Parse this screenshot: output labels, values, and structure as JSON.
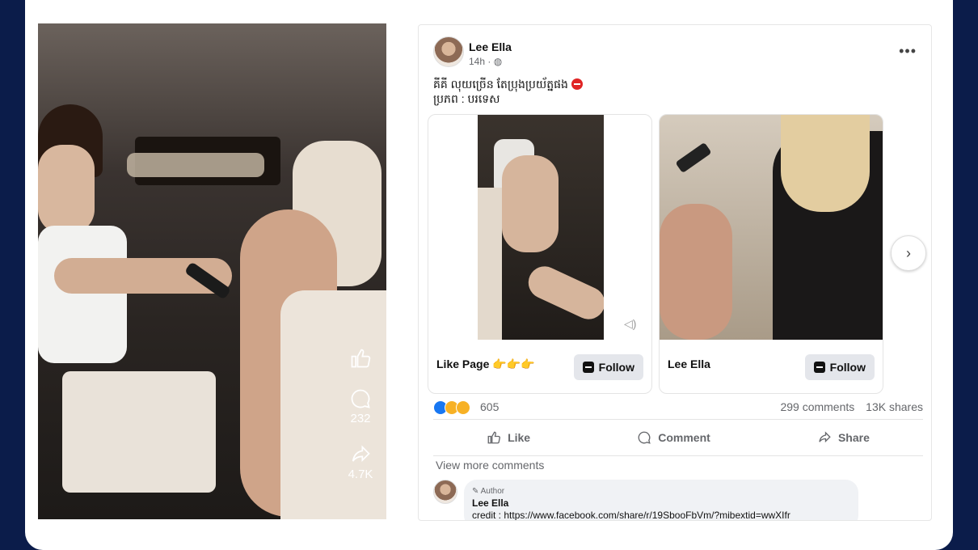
{
  "video": {
    "likes_label": "",
    "comments_count": "232",
    "shares_count": "4.7K"
  },
  "post": {
    "author": "Lee Ella",
    "time": "14h · ",
    "caption_line1": "គីគី លុយច្រើន តែប្រុងប្រយ័ត្នផង",
    "caption_line2": "ប្រភព : បរទេស",
    "tiles": [
      {
        "name": "Like Page",
        "emoji": "👉👉👉",
        "follow": "Follow"
      },
      {
        "name": "Lee Ella",
        "emoji": "",
        "follow": "Follow"
      }
    ],
    "reactions_count": "605",
    "comments": "299 comments",
    "shares": "13K shares",
    "actions": [
      "Like",
      "Comment",
      "Share"
    ],
    "view_more": "View more comments",
    "comment": {
      "badge": "Author",
      "name": "Lee Ella",
      "text": "credit : https://www.facebook.com/share/r/19SbooFbVm/?mibextid=wwXIfr"
    }
  },
  "colors": {
    "background": "#0b1c4a",
    "card": "#ffffff",
    "button": "#e4e6eb"
  }
}
